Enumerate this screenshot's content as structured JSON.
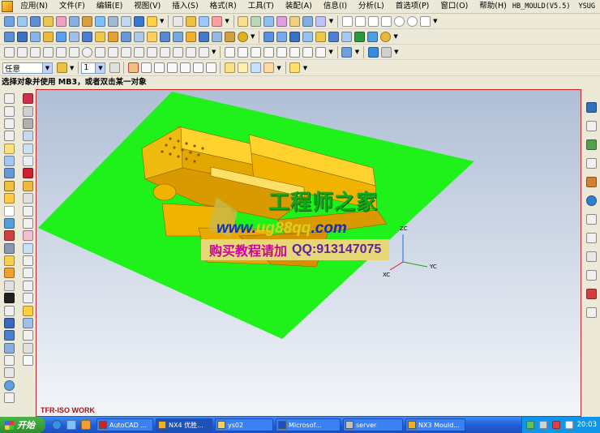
{
  "menu": {
    "items": [
      "应用(N)",
      "文件(F)",
      "编辑(E)",
      "视图(V)",
      "插入(S)",
      "格式(R)",
      "工具(T)",
      "装配(A)",
      "信息(I)",
      "分析(L)",
      "首选项(P)",
      "窗口(O)",
      "帮助(H)"
    ],
    "app_name": "HB_MOULD(V5.5)",
    "user": "YSUG"
  },
  "toolbar": {
    "filter_value": "任意",
    "layer_value": "1"
  },
  "cue_line": "选择对象并使用 MB3，或者双击某一对象",
  "viewport": {
    "view_label": "TFR-ISO WORK",
    "axes": {
      "z": "ZC",
      "x": "XC",
      "y": "YC"
    },
    "ground_color": "#1ff21a",
    "part_color": "#f5b800"
  },
  "watermark": {
    "title": "工程师之家",
    "url_prefix": "www.",
    "url_highlight": "ug88qq",
    "url_suffix": ".com",
    "promo": "购买教程请加",
    "qq": "QQ:913147075"
  },
  "taskbar": {
    "start_label": "开始",
    "tasks": [
      "AutoCAD ...",
      "NX4 优胜...",
      "ys02",
      "Microsof...",
      "server",
      "NX3 Mould..."
    ],
    "clock": "20:03"
  },
  "icons": {
    "start": "windows-flag-icon",
    "app": "nx-logo-icon"
  }
}
